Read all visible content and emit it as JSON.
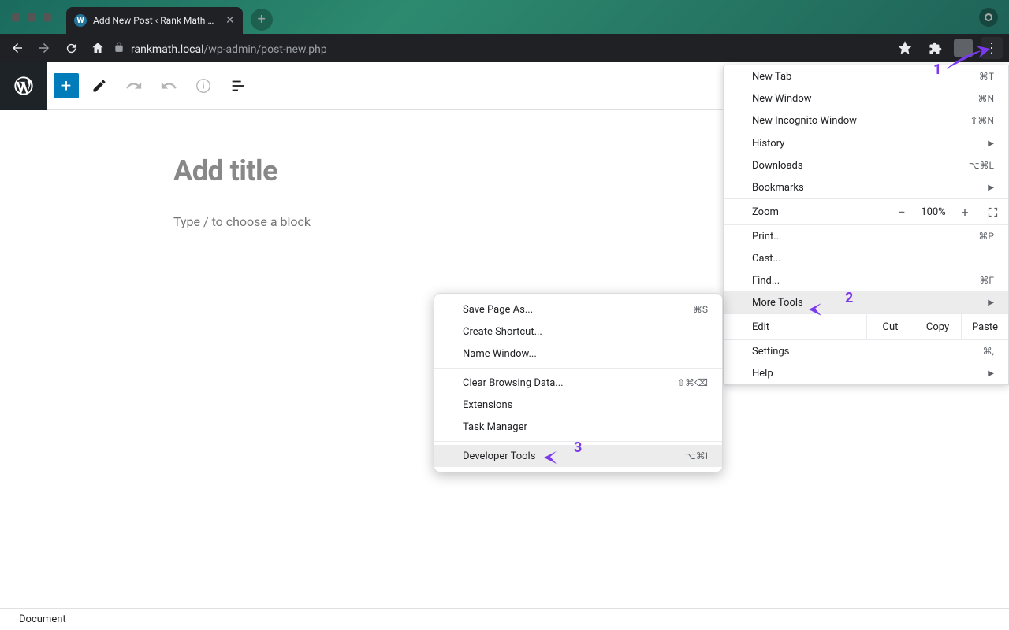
{
  "tab": {
    "title": "Add New Post ‹ Rank Math — W"
  },
  "url": {
    "domain": "rankmath.local",
    "path": "/wp-admin/post-new.php"
  },
  "editor": {
    "title_placeholder": "Add title",
    "block_hint": "Type / to choose a block",
    "status": "Document"
  },
  "chrome_menu": {
    "new_tab": "New Tab",
    "new_tab_sc": "⌘T",
    "new_window": "New Window",
    "new_window_sc": "⌘N",
    "new_incognito": "New Incognito Window",
    "new_incognito_sc": "⇧⌘N",
    "history": "History",
    "downloads": "Downloads",
    "downloads_sc": "⌥⌘L",
    "bookmarks": "Bookmarks",
    "zoom": "Zoom",
    "zoom_minus": "−",
    "zoom_val": "100%",
    "zoom_plus": "+",
    "print": "Print...",
    "print_sc": "⌘P",
    "cast": "Cast...",
    "find": "Find...",
    "find_sc": "⌘F",
    "more_tools": "More Tools",
    "edit": "Edit",
    "cut": "Cut",
    "copy": "Copy",
    "paste": "Paste",
    "settings": "Settings",
    "settings_sc": "⌘,",
    "help": "Help"
  },
  "submenu": {
    "save_page": "Save Page As...",
    "save_page_sc": "⌘S",
    "create_shortcut": "Create Shortcut...",
    "name_window": "Name Window...",
    "clear_browsing": "Clear Browsing Data...",
    "clear_browsing_sc": "⇧⌘⌫",
    "extensions": "Extensions",
    "task_manager": "Task Manager",
    "dev_tools": "Developer Tools",
    "dev_tools_sc": "⌥⌘I"
  },
  "annotations": {
    "n1": "1",
    "n2": "2",
    "n3": "3"
  }
}
